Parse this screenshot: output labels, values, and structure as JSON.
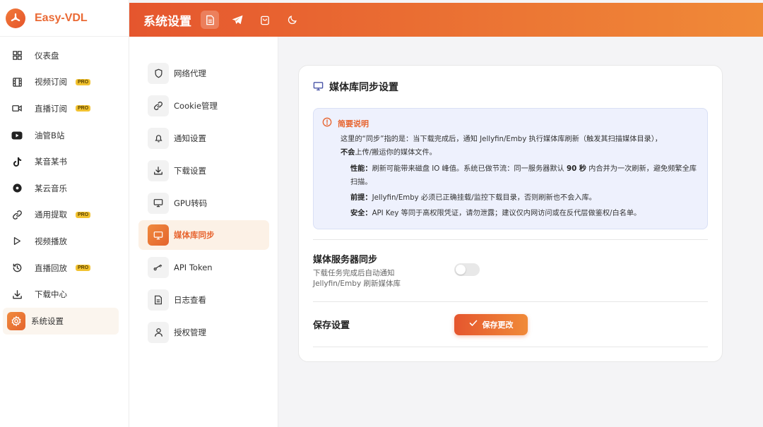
{
  "app": {
    "name": "Easy-VDL"
  },
  "sidebar": {
    "items": [
      {
        "label": "仪表盘",
        "icon": "dashboard-icon",
        "pro": false
      },
      {
        "label": "视频订阅",
        "icon": "film-icon",
        "pro": true
      },
      {
        "label": "直播订阅",
        "icon": "video-camera-icon",
        "pro": true
      },
      {
        "label": "油管B站",
        "icon": "youtube-icon",
        "pro": false
      },
      {
        "label": "某音某书",
        "icon": "tiktok-icon",
        "pro": false
      },
      {
        "label": "某云音乐",
        "icon": "music-disc-icon",
        "pro": false
      },
      {
        "label": "通用提取",
        "icon": "link-icon",
        "pro": true
      },
      {
        "label": "视频播放",
        "icon": "play-icon",
        "pro": false
      },
      {
        "label": "直播回放",
        "icon": "history-icon",
        "pro": true
      },
      {
        "label": "下载中心",
        "icon": "download-icon",
        "pro": false
      },
      {
        "label": "系统设置",
        "icon": "gear-icon",
        "pro": false,
        "active": true
      }
    ],
    "pro_badge": "PRO"
  },
  "topbar": {
    "title": "系统设置",
    "icons": [
      "document-icon",
      "telegram-icon",
      "bag-icon",
      "moon-icon"
    ]
  },
  "settings_menu": {
    "items": [
      {
        "label": "网络代理",
        "icon": "shield-icon"
      },
      {
        "label": "Cookie管理",
        "icon": "link-icon"
      },
      {
        "label": "通知设置",
        "icon": "bell-icon"
      },
      {
        "label": "下载设置",
        "icon": "download-icon"
      },
      {
        "label": "GPU转码",
        "icon": "monitor-icon"
      },
      {
        "label": "媒体库同步",
        "icon": "monitor-icon",
        "active": true
      },
      {
        "label": "API Token",
        "icon": "key-icon"
      },
      {
        "label": "日志查看",
        "icon": "file-icon"
      },
      {
        "label": "授权管理",
        "icon": "user-icon"
      }
    ]
  },
  "card": {
    "title": "媒体库同步设置",
    "info": {
      "title": "简要说明",
      "intro": "这里的“同步”指的是：当下载完成后，通知 Jellyfin/Emby 执行媒体库刷新（触发其扫描媒体目录），",
      "intro_bold": "不会",
      "intro_end": "上传/搬运你的媒体文件。",
      "perf_label": "性能：",
      "perf_text_a": "刷新可能带来磁盘 IO 峰值。系统已做节流：同一服务器默认 ",
      "perf_bold": "90 秒",
      "perf_text_b": " 内合并为一次刷新，避免频繁全库扫描。",
      "pre_label": "前提：",
      "pre_text": "Jellyfin/Emby 必须已正确挂载/监控下载目录，否则刷新也不会入库。",
      "sec_label": "安全：",
      "sec_text": "API Key 等同于高权限凭证，请勿泄露；建议仅内网访问或在反代层做鉴权/白名单。"
    },
    "sync": {
      "title": "媒体服务器同步",
      "desc_line1": "下载任务完成后自动通知",
      "desc_line2": "Jellyfin/Emby 刷新媒体库",
      "enabled": false
    },
    "save": {
      "label": "保存设置",
      "button": "保存更改"
    }
  },
  "colors": {
    "accent": "#e7642f",
    "accent_light": "#f08a38",
    "info_bg": "#eef1fd"
  }
}
